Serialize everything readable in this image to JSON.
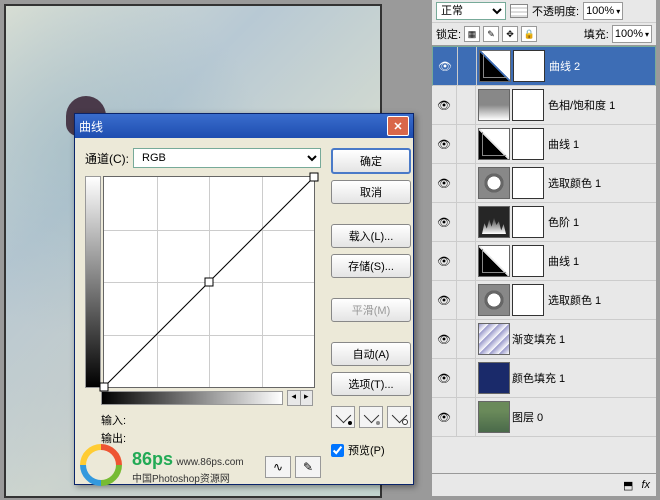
{
  "panel": {
    "blend_mode": "正常",
    "opacity_label": "不透明度:",
    "opacity_value": "100%",
    "lock_label": "锁定:",
    "fill_label": "填充:",
    "fill_value": "100%",
    "layers": [
      {
        "name": "曲线 2",
        "thumb": "curves",
        "mask": true,
        "selected": true
      },
      {
        "name": "色相/饱和度 1",
        "thumb": "hue",
        "mask": true
      },
      {
        "name": "曲线 1",
        "thumb": "curves",
        "mask": true
      },
      {
        "name": "选取颜色 1",
        "thumb": "selcol",
        "mask": true
      },
      {
        "name": "色阶 1",
        "thumb": "levels",
        "mask": true
      },
      {
        "name": "曲线 1",
        "thumb": "curves",
        "mask": true
      },
      {
        "name": "选取颜色 1",
        "thumb": "selcol",
        "mask": true
      },
      {
        "name": "渐变填充 1",
        "thumb": "grad",
        "mask": false
      },
      {
        "name": "颜色填充 1",
        "thumb": "solid",
        "mask": false
      },
      {
        "name": "图层 0",
        "thumb": "img",
        "mask": false
      }
    ]
  },
  "dialog": {
    "title": "曲线",
    "channel_label": "通道(C):",
    "channel_value": "RGB",
    "input_label": "输入:",
    "output_label": "输出:",
    "buttons": {
      "ok": "确定",
      "cancel": "取消",
      "load": "载入(L)...",
      "save": "存储(S)...",
      "smooth": "平滑(M)",
      "auto": "自动(A)",
      "options": "选项(T)..."
    },
    "preview_label": "预览(P)"
  },
  "watermark": {
    "brand": "86ps",
    "url": "www.86ps.com",
    "tagline": "中国Photoshop资源网"
  }
}
